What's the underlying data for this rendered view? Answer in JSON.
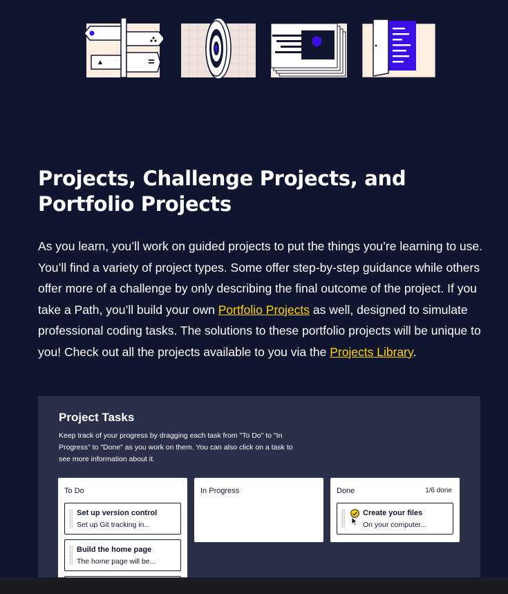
{
  "title": "Projects, Challenge Projects, and Portfolio Projects",
  "body": {
    "part1": "As you learn, you’ll work on guided projects to put the things you’re learning to use. You’ll find a variety of project types. Some offer step-by-step guidance while others offer more of a challenge by only describing the final outcome of the project. If you take a Path, you’ll build your own ",
    "link1": "Portfolio Projects",
    "part2": " as well, designed to simulate professional coding tasks. The solutions to these portfolio projects will be unique to you! Check out all the projects available to you via the ",
    "link2": "Projects Library",
    "part3": "."
  },
  "illustrations": [
    {
      "icon": "signpost-icon"
    },
    {
      "icon": "target-icon"
    },
    {
      "icon": "hexagon-card-icon"
    },
    {
      "icon": "open-door-icon"
    }
  ],
  "tasks_panel": {
    "title": "Project Tasks",
    "description": "Keep track of your progress by dragging each task from \"To Do\" to \"In Progress\" to \"Done\" as you work on them. You can also click on a task to see more information about it.",
    "columns": {
      "todo": {
        "label": "To Do",
        "cards": [
          {
            "title": "Set up version control",
            "subtitle": "Set up Git tracking in..."
          },
          {
            "title": "Build the home page",
            "subtitle": "The home page will be..."
          }
        ]
      },
      "in_progress": {
        "label": "In Progress"
      },
      "done": {
        "label": "Done",
        "count": "1/6 done",
        "cards": [
          {
            "title": "Create your files",
            "subtitle": "On your computer..."
          }
        ]
      }
    }
  },
  "colors": {
    "background": "#10162f",
    "link": "#ffd300",
    "panel": "#2a2f4a",
    "accent": "#3a10e5",
    "cream": "#fdeee2"
  }
}
